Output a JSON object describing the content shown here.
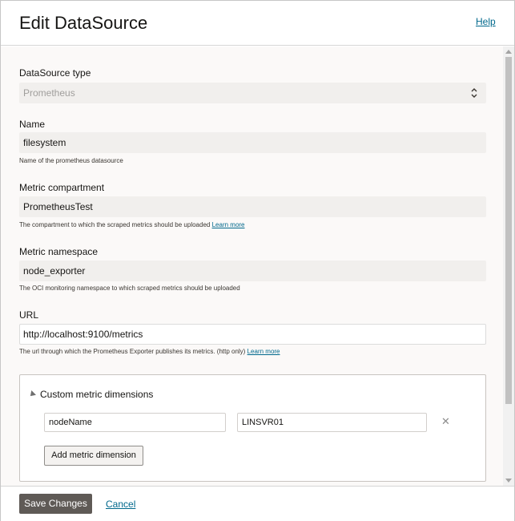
{
  "header": {
    "title": "Edit DataSource",
    "help_label": "Help"
  },
  "form": {
    "datasource_type": {
      "label": "DataSource type",
      "value": "Prometheus"
    },
    "name": {
      "label": "Name",
      "value": "filesystem",
      "help": "Name of the prometheus datasource"
    },
    "metric_compartment": {
      "label": "Metric compartment",
      "value": "PrometheusTest",
      "help": "The compartment to which the scraped metrics should be uploaded",
      "learn_more": "Learn more"
    },
    "metric_namespace": {
      "label": "Metric namespace",
      "value": "node_exporter",
      "help": "The OCI monitoring namespace to which scraped metrics should be uploaded"
    },
    "url": {
      "label": "URL",
      "value": "http://localhost:9100/metrics",
      "help": "The url through which the Prometheus Exporter publishes its metrics. (http only)",
      "learn_more": "Learn more"
    },
    "custom_dimensions": {
      "title": "Custom metric dimensions",
      "rows": [
        {
          "key": "nodeName",
          "value": "LINSVR01"
        }
      ],
      "add_label": "Add metric dimension"
    }
  },
  "footer": {
    "save_label": "Save Changes",
    "cancel_label": "Cancel"
  },
  "colors": {
    "primary_button": "#5f5a56",
    "link": "#00688c",
    "field_background": "#f1efed",
    "body_background": "#fbf9f8"
  }
}
